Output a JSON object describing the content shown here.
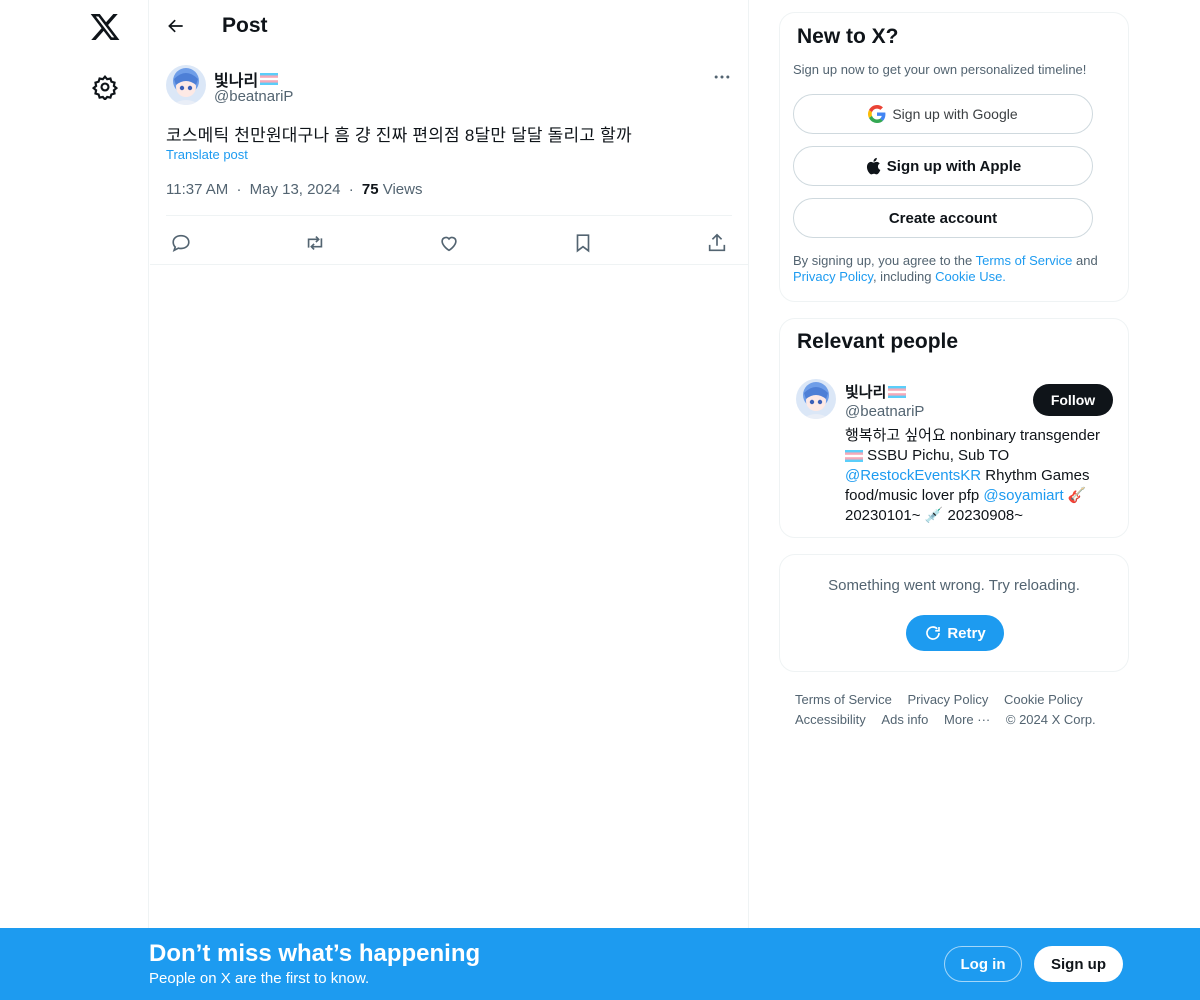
{
  "nav": {
    "logo": "x-logo-icon",
    "settings": "gear-icon"
  },
  "header": {
    "title": "Post"
  },
  "post": {
    "author_name": "빛나리",
    "author_handle": "@beatnariP",
    "text": "코스메틱 천만원대구나 흠 걍 진짜 편의점 8달만 달달 돌리고 할까",
    "translate": "Translate post",
    "time": "11:37 AM",
    "dot1": "·",
    "date": "May 13, 2024",
    "dot2": "·",
    "views_count": "75",
    "views_label": "Views"
  },
  "signup_card": {
    "title": "New to X?",
    "subtitle": "Sign up now to get your own personalized timeline!",
    "google": "Sign up with Google",
    "apple": "Sign up with Apple",
    "create": "Create account",
    "terms_1": "By signing up, you agree to the ",
    "terms_link1": "Terms of Service",
    "terms_2": " and ",
    "terms_link2": "Privacy Policy",
    "terms_3": ", including ",
    "terms_link3": "Cookie Use."
  },
  "relevant": {
    "title": "Relevant people",
    "name": "빛나리",
    "handle": "@beatnariP",
    "follow": "Follow",
    "bio_1": "행복하고 싶어요 nonbinary transgender",
    "bio_2": " SSBU Pichu, Sub TO ",
    "bio_link1": "@RestockEventsKR",
    "bio_3": " Rhythm Games food/music lover pfp ",
    "bio_link2": "@soyamiart",
    "bio_4": " 🎸 20230101~ 💉 20230908~"
  },
  "error_card": {
    "message": "Something went wrong. Try reloading.",
    "retry": "Retry"
  },
  "footer": {
    "links": [
      "Terms of Service",
      "Privacy Policy",
      "Cookie Policy",
      "Accessibility",
      "Ads info",
      "More ···",
      "© 2024 X Corp."
    ]
  },
  "bottom_bar": {
    "title": "Don’t miss what’s happening",
    "subtitle": "People on X are the first to know.",
    "login": "Log in",
    "signup": "Sign up"
  },
  "colors": {
    "accent": "#1d9bf0",
    "text": "#0f1419",
    "muted": "#536471",
    "border": "#eff3f4"
  }
}
